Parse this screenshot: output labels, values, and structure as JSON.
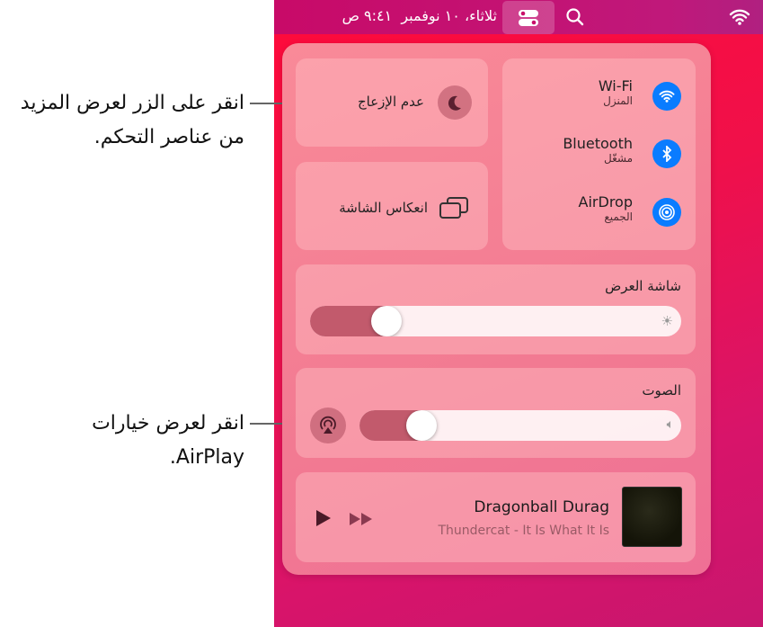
{
  "callouts": {
    "top": "انقر على الزر لعرض المزيد من عناصر التحكم.",
    "bottom": "انقر لعرض خيارات AirPlay."
  },
  "menubar": {
    "datetime": "ثلاثاء، ١٠ نوفمبر  ٩:٤١ ص",
    "icons": [
      "control-center-icon",
      "search-icon",
      "wifi-icon"
    ]
  },
  "connectivity": [
    {
      "title": "Wi-Fi",
      "subtitle": "المنزل",
      "icon": "wifi-icon"
    },
    {
      "title": "Bluetooth",
      "subtitle": "مشغّل",
      "icon": "bluetooth-icon"
    },
    {
      "title": "AirDrop",
      "subtitle": "الجميع",
      "icon": "airdrop-icon"
    }
  ],
  "dnd": {
    "label": "عدم الإزعاج"
  },
  "mirroring": {
    "label": "انعكاس الشاشة"
  },
  "display": {
    "label": "شاشة العرض",
    "brightness_percent": 18
  },
  "sound": {
    "label": "الصوت",
    "volume_percent": 16
  },
  "now_playing": {
    "title": "Dragonball Durag",
    "subtitle": "Thundercat - It Is What It Is"
  },
  "colors": {
    "accent": "#0a7cff"
  }
}
